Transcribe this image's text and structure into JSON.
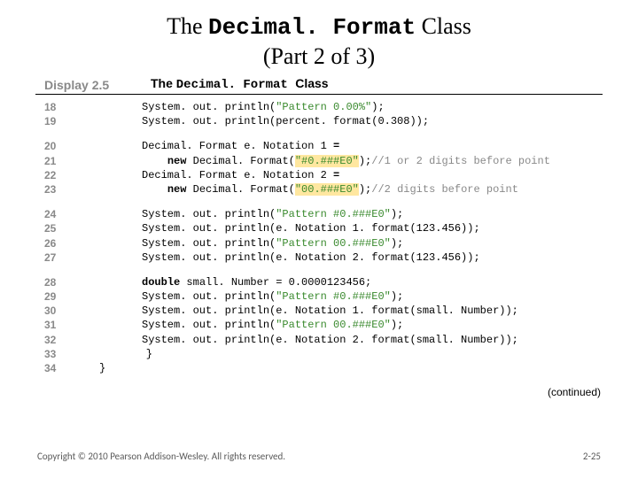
{
  "title": {
    "prefix": "The ",
    "class_name": "Decimal. Format",
    "suffix": " Class",
    "line2": "(Part 2 of 3)"
  },
  "display": {
    "label": "Display 2.5",
    "title_prefix": "The ",
    "title_class": "Decimal. Format ",
    "title_suffix": "Class"
  },
  "blocks": [
    {
      "lines": [
        {
          "n": "18",
          "segs": [
            {
              "t": "pl",
              "v": "System. out. println("
            },
            {
              "t": "str",
              "v": "\"Pattern 0.00%\""
            },
            {
              "t": "pl",
              "v": ");"
            }
          ]
        },
        {
          "n": "19",
          "segs": [
            {
              "t": "pl",
              "v": "System. out. println(percent. format(0.308));"
            }
          ]
        }
      ]
    },
    {
      "lines": [
        {
          "n": "20",
          "segs": [
            {
              "t": "pl",
              "v": "Decimal. Format e. Notation 1 "
            },
            {
              "t": "kw",
              "v": "="
            }
          ]
        },
        {
          "n": "21",
          "segs": [
            {
              "t": "pl",
              "v": "    "
            },
            {
              "t": "kw",
              "v": "new"
            },
            {
              "t": "pl",
              "v": " Decimal. Format("
            },
            {
              "t": "strhl",
              "v": "\"#0.###E0\""
            },
            {
              "t": "pl",
              "v": ");"
            },
            {
              "t": "cm",
              "v": "//1 or 2 digits before point"
            }
          ]
        },
        {
          "n": "22",
          "segs": [
            {
              "t": "pl",
              "v": "Decimal. Format e. Notation 2 "
            },
            {
              "t": "kw",
              "v": "="
            }
          ]
        },
        {
          "n": "23",
          "segs": [
            {
              "t": "pl",
              "v": "    "
            },
            {
              "t": "kw",
              "v": "new"
            },
            {
              "t": "pl",
              "v": " Decimal. Format("
            },
            {
              "t": "strhl",
              "v": "\"00.###E0\""
            },
            {
              "t": "pl",
              "v": ");"
            },
            {
              "t": "cm",
              "v": "//2 digits before point"
            }
          ]
        }
      ]
    },
    {
      "lines": [
        {
          "n": "24",
          "segs": [
            {
              "t": "pl",
              "v": "System. out. println("
            },
            {
              "t": "str",
              "v": "\"Pattern #0.###E0\""
            },
            {
              "t": "pl",
              "v": ");"
            }
          ]
        },
        {
          "n": "25",
          "segs": [
            {
              "t": "pl",
              "v": "System. out. println(e. Notation 1. format(123.456));"
            }
          ]
        },
        {
          "n": "26",
          "segs": [
            {
              "t": "pl",
              "v": "System. out. println("
            },
            {
              "t": "str",
              "v": "\"Pattern 00.###E0\""
            },
            {
              "t": "pl",
              "v": ");"
            }
          ]
        },
        {
          "n": "27",
          "segs": [
            {
              "t": "pl",
              "v": "System. out. println(e. Notation 2. format(123.456));"
            }
          ]
        }
      ]
    },
    {
      "lines": [
        {
          "n": "28",
          "segs": [
            {
              "t": "kw",
              "v": "double"
            },
            {
              "t": "pl",
              "v": " small. Number = 0.0000123456;"
            }
          ]
        },
        {
          "n": "29",
          "segs": [
            {
              "t": "pl",
              "v": "System. out. println("
            },
            {
              "t": "str",
              "v": "\"Pattern #0.###E0\""
            },
            {
              "t": "pl",
              "v": ");"
            }
          ]
        },
        {
          "n": "30",
          "segs": [
            {
              "t": "pl",
              "v": "System. out. println(e. Notation 1. format(small. Number));"
            }
          ]
        },
        {
          "n": "31",
          "segs": [
            {
              "t": "pl",
              "v": "System. out. println("
            },
            {
              "t": "str",
              "v": "\"Pattern 00.###E0\""
            },
            {
              "t": "pl",
              "v": ");"
            }
          ]
        },
        {
          "n": "32",
          "segs": [
            {
              "t": "pl",
              "v": "System. out. println(e. Notation 2. format(small. Number));"
            }
          ]
        },
        {
          "n": "33",
          "segs": [
            {
              "t": "pl",
              "v": "    }"
            }
          ],
          "dedent": 1
        },
        {
          "n": "34",
          "segs": [
            {
              "t": "pl",
              "v": "}"
            }
          ],
          "dedent": 2
        }
      ]
    }
  ],
  "continued": "(continued)",
  "footer": {
    "copyright": "Copyright © 2010 Pearson Addison-Wesley. All rights reserved.",
    "page": "2-25"
  }
}
